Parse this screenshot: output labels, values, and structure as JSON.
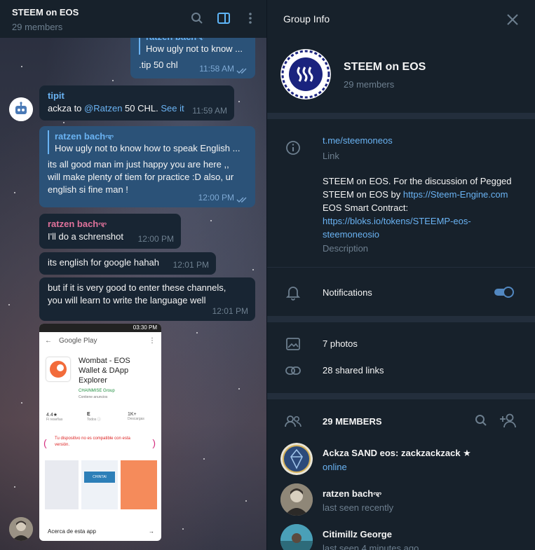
{
  "chat": {
    "title": "STEEM on EOS",
    "subtitle": "29 members",
    "messages": {
      "m1": {
        "quote_name": "ratzen bachಞ",
        "quote_text": "How ugly not to know ...",
        "text": ".tip 50 chl",
        "time": "11:58 AM"
      },
      "m2": {
        "sender": "tipit",
        "text_before": "ackza to ",
        "mention": "@Ratzen",
        "text_after": " 50 CHL. ",
        "link": "See it",
        "time": "11:59 AM"
      },
      "m3": {
        "quote_name": "ratzen bachಞ",
        "quote_text": "How ugly not to know how to speak English ...",
        "line1": "its all good man im just happy you are here ,,",
        "line2": "will make plenty of tiem for practice :D also, ur",
        "line3": "english si fine man !",
        "time": "12:00 PM"
      },
      "m4": {
        "sender": "ratzen bachಞ",
        "text": "I'll do a schrenshot",
        "time": "12:00 PM"
      },
      "m5": {
        "text": "its english for google hahah",
        "time": "12:01 PM"
      },
      "m6": {
        "line1": "but if it is very good to enter these channels,",
        "line2": "you will learn to write the language well",
        "time": "12:01 PM"
      }
    },
    "screenshot": {
      "status_time": "03:30 PM",
      "store": "Google Play",
      "app_name_1": "Wombat - EOS",
      "app_name_2": "Wallet & DApp",
      "app_name_3": "Explorer",
      "developer": "CHAINMISE Group",
      "contains_ads": "Contiene anuncios",
      "rating": "4.4★",
      "rating_label": "Fi reseñas",
      "content_rating": "E",
      "content_label": "Todos ⓘ",
      "downloads": "1K+",
      "downloads_label": "Descargas",
      "warning_1": "Tu dispositivo no es compatible con esta",
      "warning_2": "versión.",
      "brand": "CHINTAI",
      "about": "Acerca de esta app"
    }
  },
  "info": {
    "header_title": "Group Info",
    "group_name": "STEEM on EOS",
    "group_members": "29 members",
    "link": "t.me/steemoneos",
    "link_label": "Link",
    "desc_1": "STEEM on EOS. For the discussion of Pegged",
    "desc_2a": "STEEM on EOS by ",
    "desc_2b": "https://Steem-Engine.com",
    "desc_3": "EOS Smart Contract:",
    "desc_4": "https://bloks.io/tokens/STEEMP-eos-",
    "desc_5": "steemoneosio",
    "desc_label": "Description",
    "notifications": "Notifications",
    "photos": "7 photos",
    "links": "28 shared links",
    "members_header": "29 MEMBERS",
    "members": [
      {
        "name": "Ackza SAND eos: zackzackzack ★",
        "status": "online"
      },
      {
        "name": "ratzen bachಞ",
        "status": "last seen recently"
      },
      {
        "name": "Citimillz George",
        "status": "last seen 4 minutes ago"
      }
    ]
  },
  "colors": {
    "accent": "#6ab3f3",
    "bg": "#17212b",
    "incoming": "#182533",
    "outgoing": "#2b5278",
    "sender_pink": "#e0729b",
    "star": "#5eb5f7"
  }
}
